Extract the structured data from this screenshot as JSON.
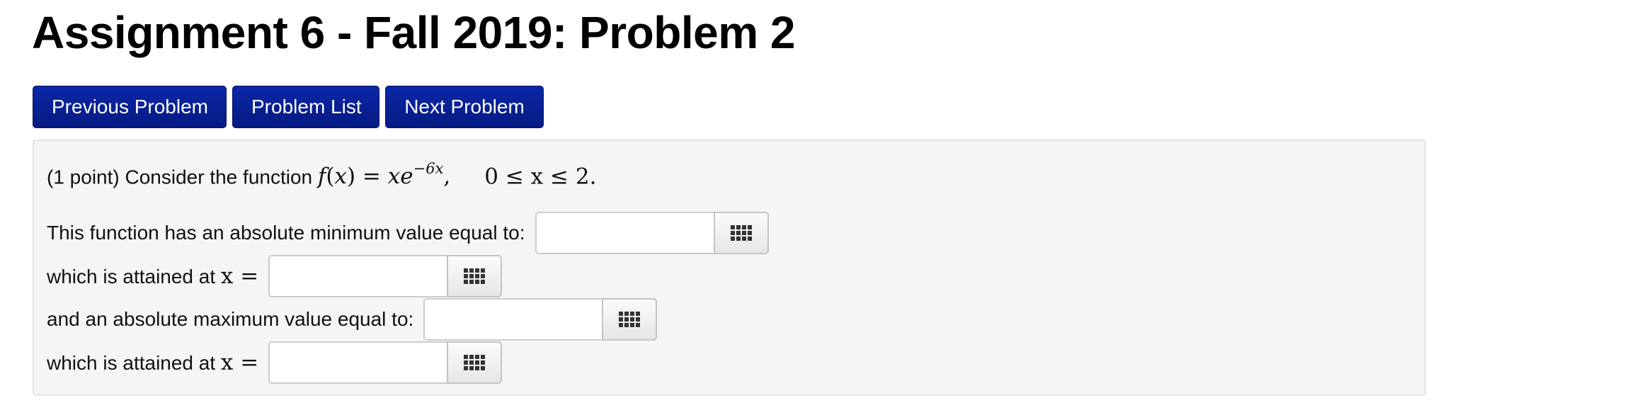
{
  "page": {
    "title": "Assignment 6 - Fall 2019: Problem 2"
  },
  "nav": {
    "previous_label": "Previous Problem",
    "list_label": "Problem List",
    "next_label": "Next Problem"
  },
  "problem": {
    "points": "(1 point)",
    "intro_text": "Consider the function",
    "function_name": "f",
    "function_var": "x",
    "function_equals": "=",
    "function_rhs_base": "xe",
    "function_rhs_exp": "−6x",
    "domain_text": "0 ≤ x ≤ 2.",
    "questions": [
      {
        "label": "This function has an absolute minimum value equal to:",
        "value": "",
        "placeholder": ""
      },
      {
        "label": "which is attained at",
        "math_suffix": "x =",
        "value": "",
        "placeholder": ""
      },
      {
        "label": "and an absolute maximum value equal to:",
        "value": "",
        "placeholder": ""
      },
      {
        "label": "which is attained at",
        "math_suffix": "x =",
        "value": "",
        "placeholder": ""
      }
    ]
  },
  "icons": {
    "keypad": "keypad-grid-icon"
  },
  "colors": {
    "nav_button_bg": "#0a2196",
    "problem_box_bg": "#f5f5f5"
  }
}
